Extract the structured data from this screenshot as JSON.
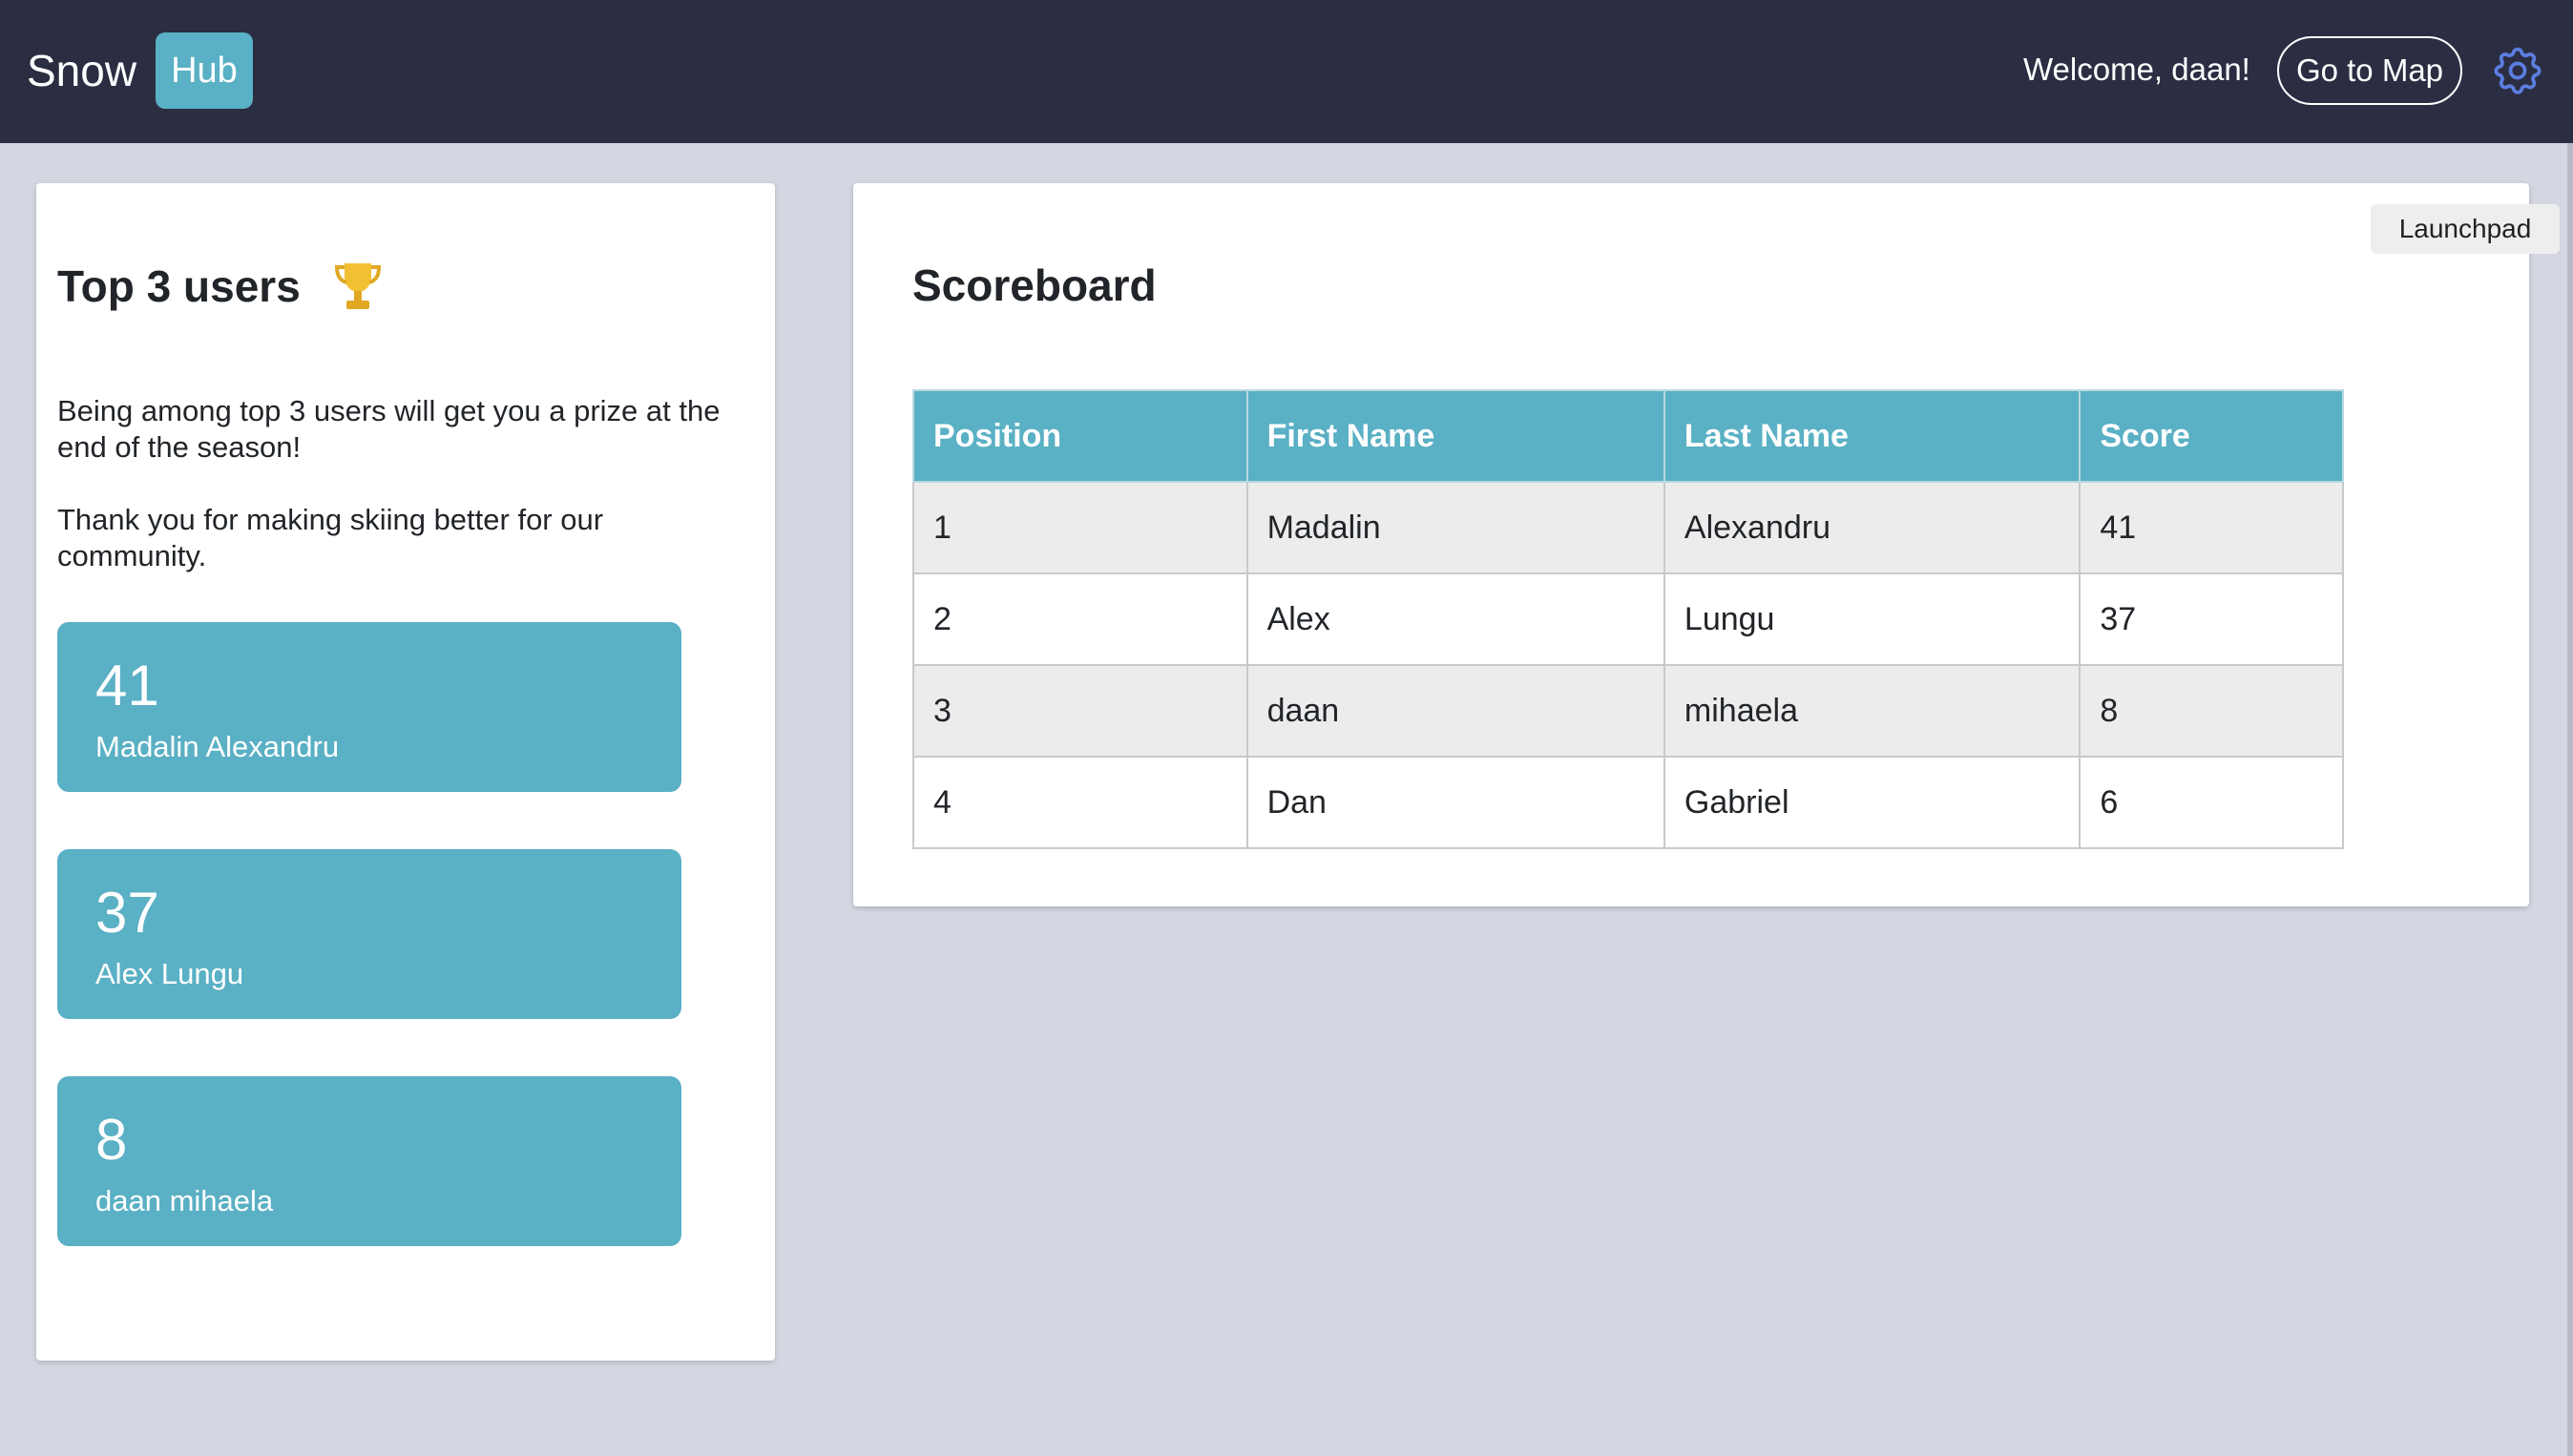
{
  "header": {
    "brand_text": "Snow",
    "brand_badge": "Hub",
    "welcome": "Welcome, daan!",
    "map_button": "Go to Map",
    "settings_icon": "gear-icon",
    "bg_color": "#2b2e42",
    "accent_color": "#5ab0c4"
  },
  "left": {
    "title": "Top 3 users",
    "title_icon": "trophy-icon",
    "para1": "Being among top 3 users will get you a prize at the end of the season!",
    "para2": "Thank you for making skiing better for our community.",
    "top": [
      {
        "score": "41",
        "name": "Madalin Alexandru"
      },
      {
        "score": "37",
        "name": "Alex Lungu"
      },
      {
        "score": "8",
        "name": "daan mihaela"
      }
    ]
  },
  "scoreboard": {
    "title": "Scoreboard",
    "headers": [
      "Position",
      "First Name",
      "Last Name",
      "Score"
    ],
    "rows": [
      [
        "1",
        "Madalin",
        "Alexandru",
        "41"
      ],
      [
        "2",
        "Alex",
        "Lungu",
        "37"
      ],
      [
        "3",
        "daan",
        "mihaela",
        "8"
      ],
      [
        "4",
        "Dan",
        "Gabriel",
        "6"
      ]
    ]
  },
  "launchpad": "Launchpad"
}
